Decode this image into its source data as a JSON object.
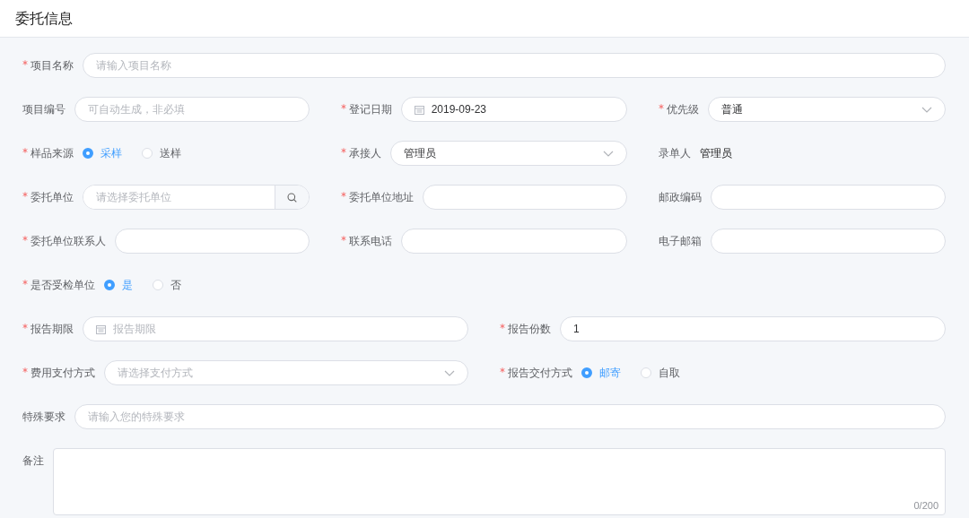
{
  "header": {
    "title": "委托信息"
  },
  "rows": [
    {
      "fields": [
        {
          "kind": "text",
          "label": "项目名称",
          "required": true,
          "placeholder": "请输入项目名称"
        }
      ]
    },
    {
      "fields": [
        {
          "kind": "text",
          "label": "项目编号",
          "required": false,
          "placeholder": "可自动生成，非必填"
        },
        {
          "kind": "date",
          "label": "登记日期",
          "required": true,
          "value": "2019-09-23"
        },
        {
          "kind": "select",
          "label": "优先级",
          "required": true,
          "value": "普通"
        }
      ]
    },
    {
      "fields": [
        {
          "kind": "radio",
          "label": "样品来源",
          "required": true,
          "options": [
            {
              "label": "采样",
              "selected": true
            },
            {
              "label": "送样",
              "selected": false
            }
          ]
        },
        {
          "kind": "select",
          "label": "承接人",
          "required": true,
          "value": "管理员"
        },
        {
          "kind": "static",
          "label": "录单人",
          "required": false,
          "value": "管理员"
        }
      ]
    },
    {
      "fields": [
        {
          "kind": "search",
          "label": "委托单位",
          "required": true,
          "placeholder": "请选择委托单位"
        },
        {
          "kind": "text",
          "label": "委托单位地址",
          "required": true
        },
        {
          "kind": "text",
          "label": "邮政编码",
          "required": false
        }
      ]
    },
    {
      "fields": [
        {
          "kind": "text",
          "label": "委托单位联系人",
          "required": true
        },
        {
          "kind": "text",
          "label": "联系电话",
          "required": true
        },
        {
          "kind": "text",
          "label": "电子邮箱",
          "required": false
        }
      ]
    },
    {
      "fields": [
        {
          "kind": "radio",
          "label": "是否受检单位",
          "required": true,
          "options": [
            {
              "label": "是",
              "selected": true
            },
            {
              "label": "否",
              "selected": false
            }
          ]
        }
      ]
    },
    {
      "fields": [
        {
          "kind": "date",
          "label": "报告期限",
          "required": true,
          "placeholder": "报告期限"
        },
        {
          "kind": "text",
          "label": "报告份数",
          "required": true,
          "value": "1"
        }
      ]
    },
    {
      "fields": [
        {
          "kind": "select",
          "label": "费用支付方式",
          "required": true,
          "placeholder": "请选择支付方式"
        },
        {
          "kind": "radio",
          "label": "报告交付方式",
          "required": true,
          "options": [
            {
              "label": "邮寄",
              "selected": true
            },
            {
              "label": "自取",
              "selected": false
            }
          ]
        }
      ]
    },
    {
      "fields": [
        {
          "kind": "text",
          "label": "特殊要求",
          "required": false,
          "placeholder": "请输入您的特殊要求"
        }
      ]
    },
    {
      "fields": [
        {
          "kind": "textarea",
          "label": "备注",
          "required": false,
          "counter": "0/200"
        }
      ]
    }
  ]
}
